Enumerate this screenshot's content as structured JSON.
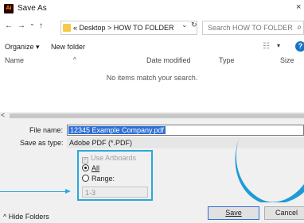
{
  "window": {
    "app_icon_text": "Ai",
    "title": "Save As",
    "close_glyph": "×"
  },
  "nav": {
    "back_glyph": "←",
    "forward_glyph": "→",
    "recent_glyph": "⌄",
    "up_glyph": "↑",
    "breadcrumb": "« Desktop  >  HOW TO FOLDER",
    "dropdown_glyph": "⌄",
    "refresh_glyph": "↻",
    "search_placeholder": "Search HOW TO FOLDER",
    "search_glyph": "⌕"
  },
  "toolbar": {
    "organize": "Organize ▾",
    "new_folder": "New folder",
    "view_glyph": "☷",
    "view_drop_glyph": "▾",
    "help_glyph": "?"
  },
  "columns": {
    "sort_caret": "^",
    "name": "Name",
    "date_modified": "Date modified",
    "type": "Type",
    "size": "Size"
  },
  "file_list": {
    "empty_message": "No items match your search."
  },
  "hscroll": {
    "left_glyph": "<"
  },
  "form": {
    "file_name_label": "File name:",
    "file_name_value": "12345 Example Company.pdf",
    "save_type_label": "Save as type:",
    "save_type_value": "Adobe PDF (*.PDF)",
    "use_artboards_label": "Use Artboards",
    "use_artboards_checked": true,
    "all_label": "All",
    "range_label": "Range:",
    "range_value": "1-3",
    "hide_folders_label": "^  Hide Folders",
    "save_button": "Save",
    "cancel_button": "Cancel"
  },
  "colors": {
    "selection": "#2f6fd6",
    "highlight": "#2aa7de",
    "help": "#1a73c7",
    "folder": "#f7c948"
  }
}
